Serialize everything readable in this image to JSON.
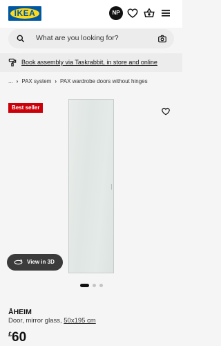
{
  "header": {
    "logo_text": "IKEA",
    "avatar_initials": "NP",
    "icons": [
      "heart-icon",
      "basket-icon",
      "menu-icon"
    ]
  },
  "search": {
    "placeholder": "What are you looking for?",
    "icon": "search-icon",
    "camera_icon": "camera-icon"
  },
  "banner": {
    "icon": "assembly-tool-icon",
    "text": "Book assembly via Taskrabbit, in store and online"
  },
  "breadcrumb": {
    "ellipsis": "...",
    "items": [
      "PAX system",
      "PAX wardrobe doors without hinges"
    ]
  },
  "product": {
    "badge": "Best seller",
    "view_3d_label": "View in 3D",
    "name": "ÅHEIM",
    "description": "Door, mirror glass,",
    "size": "50x195 cm",
    "currency": "£",
    "price": "60"
  },
  "gallery": {
    "total_images": 3,
    "active_index": 0
  },
  "colors": {
    "brand_blue": "#0058a3",
    "brand_yellow": "#ffda1a",
    "badge_red": "#cc0008",
    "dark": "#111111"
  }
}
